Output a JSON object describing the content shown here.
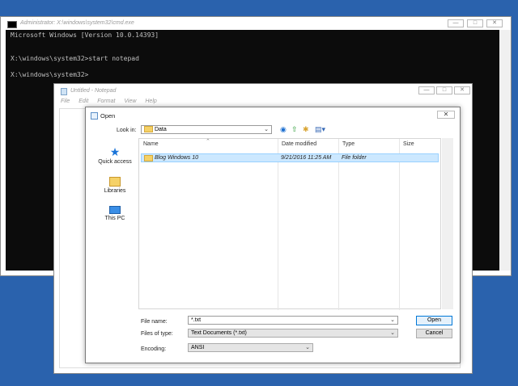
{
  "cmd": {
    "title": "Administrator: X:\\windows\\system32\\cmd.exe",
    "lines": [
      "Microsoft Windows [Version 10.0.14393]",
      "",
      "X:\\windows\\system32>start notepad",
      "",
      "X:\\windows\\system32>"
    ]
  },
  "notepad": {
    "title": "Untitled - Notepad",
    "menu": [
      "File",
      "Edit",
      "Format",
      "View",
      "Help"
    ]
  },
  "dialog": {
    "title": "Open",
    "look_in_label": "Look in:",
    "look_in_value": "Data",
    "columns": [
      "Name",
      "Date modified",
      "Type",
      "Size"
    ],
    "sidebar": [
      {
        "label": "Quick access",
        "icon": "star-icon"
      },
      {
        "label": "Libraries",
        "icon": "libraries-icon"
      },
      {
        "label": "This PC",
        "icon": "computer-icon"
      }
    ],
    "files": [
      {
        "name": "Blog Windows 10",
        "date": "9/21/2016 11:25 AM",
        "type": "File folder",
        "size": ""
      }
    ],
    "file_name_label": "File name:",
    "file_name_value": "*.txt",
    "files_of_type_label": "Files of type:",
    "files_of_type_value": "Text Documents (*.txt)",
    "encoding_label": "Encoding:",
    "encoding_value": "ANSI",
    "open_button": "Open",
    "cancel_button": "Cancel"
  },
  "colors": {
    "desktop": "#2a62ad",
    "console_bg": "#0c0c0c",
    "selection": "#cce8ff"
  }
}
